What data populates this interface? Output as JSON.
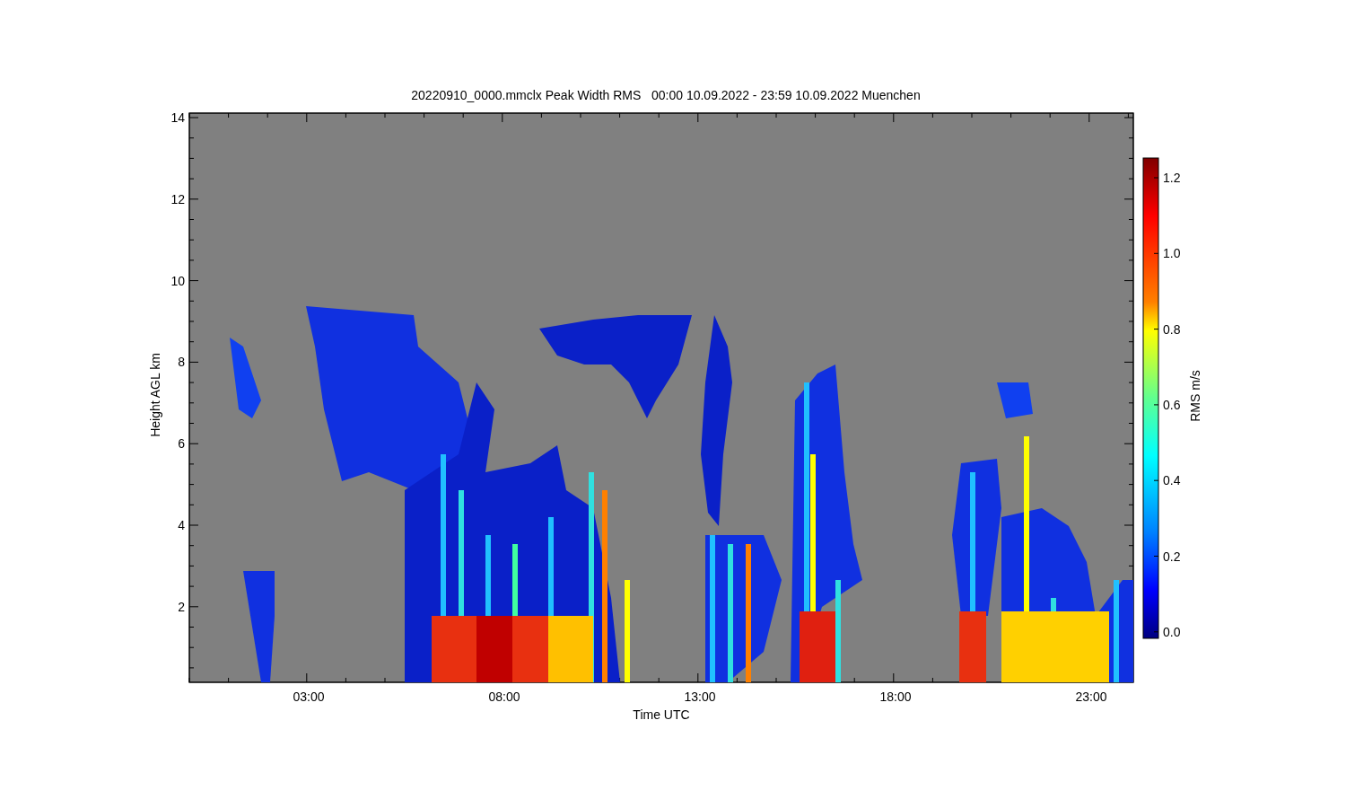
{
  "plot": {
    "title": "20220910_0000.mmclx Peak Width RMS   00:00 10.09.2022 - 23:59 10.09.2022 Muenchen",
    "xlabel": "Time UTC",
    "ylabel": "Height AGL km",
    "xticks": [
      "03:00",
      "08:00",
      "13:00",
      "18:00",
      "23:00"
    ],
    "yticks": [
      "14",
      "12",
      "10",
      "8",
      "6",
      "4",
      "2"
    ]
  },
  "colorbar": {
    "label": "RMS m/s",
    "ticks": [
      "1.2",
      "1.0",
      "0.8",
      "0.6",
      "0.4",
      "0.2",
      "0.0"
    ]
  }
}
